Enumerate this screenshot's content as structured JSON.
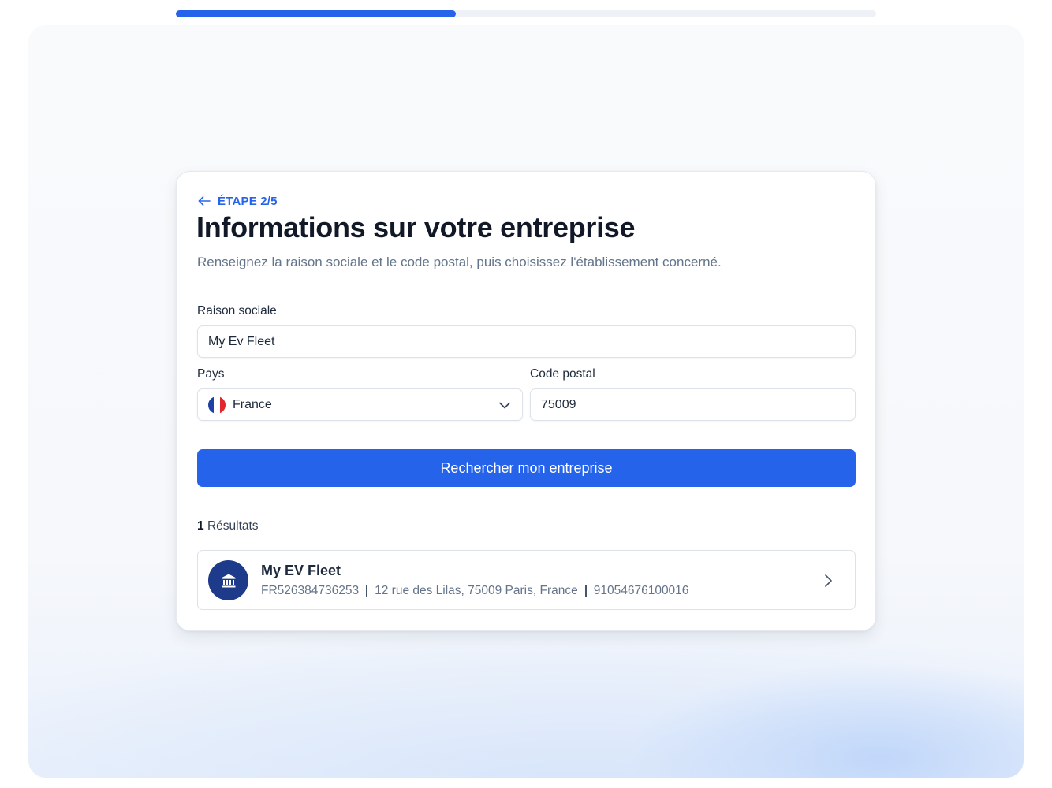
{
  "progress": {
    "value_percent": 40
  },
  "step": {
    "label": "ÉTAPE 2/5"
  },
  "title": "Informations sur votre entreprise",
  "subtitle": "Renseignez la raison sociale et le code postal, puis choisissez l'établissement concerné.",
  "form": {
    "company_name": {
      "label": "Raison sociale",
      "value": "My Ev Fleet"
    },
    "country": {
      "label": "Pays",
      "value": "France",
      "icon": "france-flag-icon"
    },
    "postal_code": {
      "label": "Code postal",
      "value": "75009"
    }
  },
  "search_button": {
    "label": "Rechercher mon entreprise"
  },
  "results": {
    "count": "1",
    "count_label": "Résultats",
    "items": [
      {
        "name": "My EV Fleet",
        "vat": "FR526384736253",
        "address": "12 rue des Lilas, 75009 Paris, France",
        "siret": "91054676100016",
        "icon": "bank-icon"
      }
    ]
  },
  "colors": {
    "accent": "#2563eb",
    "avatar_bg": "#1e3a8a",
    "title": "#111827",
    "muted": "#64748b"
  }
}
